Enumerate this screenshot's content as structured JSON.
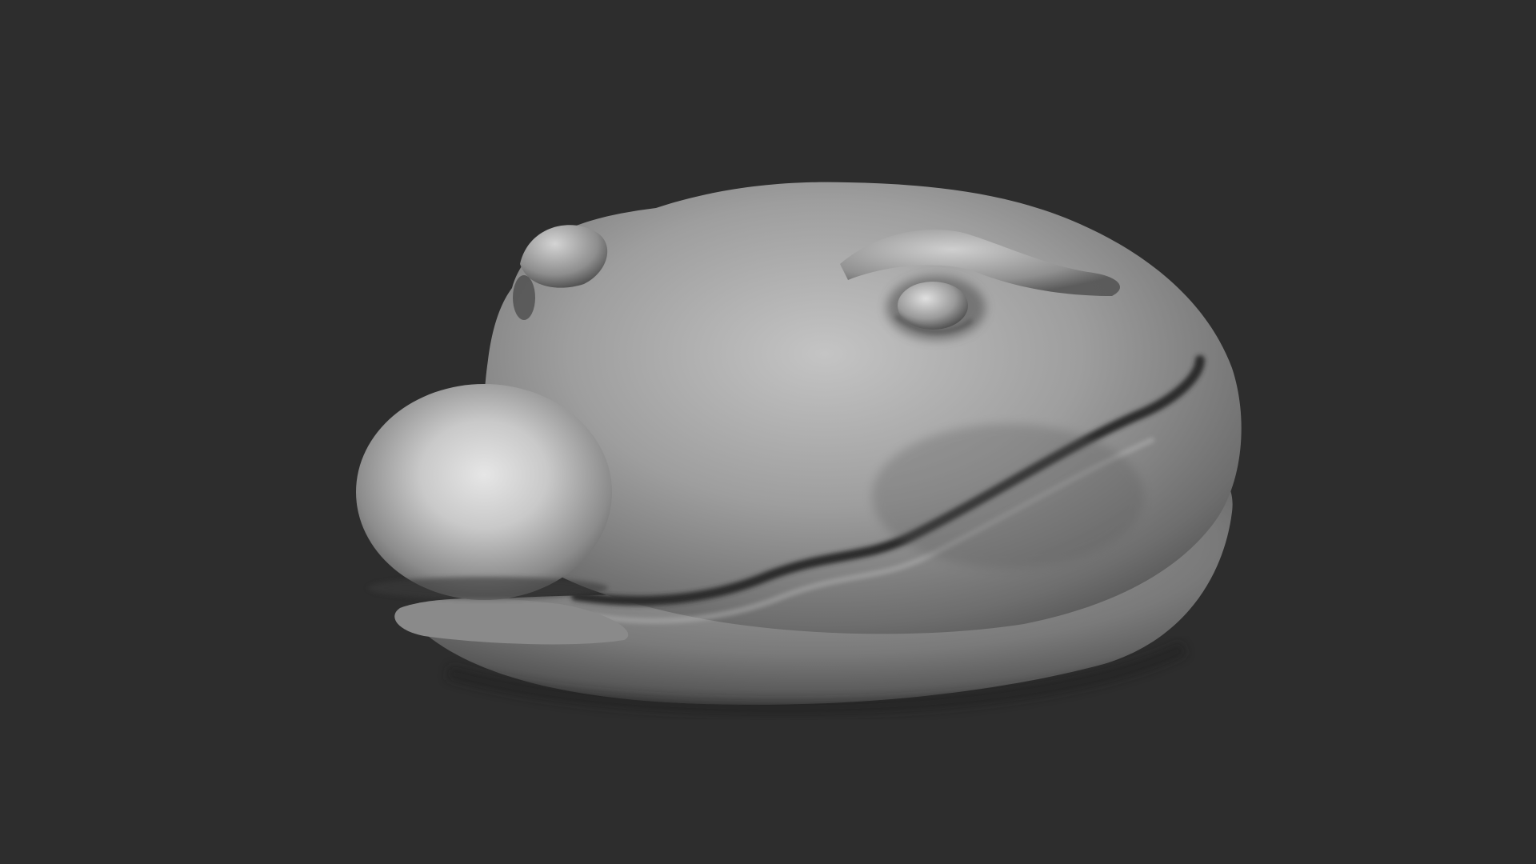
{
  "viewport": {
    "background_color": "#2d2d2d",
    "model": {
      "subject": "sculpted-creature-head",
      "material_color": "#9a9a9a",
      "highlight_color": "#d8d8d8",
      "shadow_color": "#3a3a3a",
      "shading": "matcap-grey-faceted"
    }
  }
}
